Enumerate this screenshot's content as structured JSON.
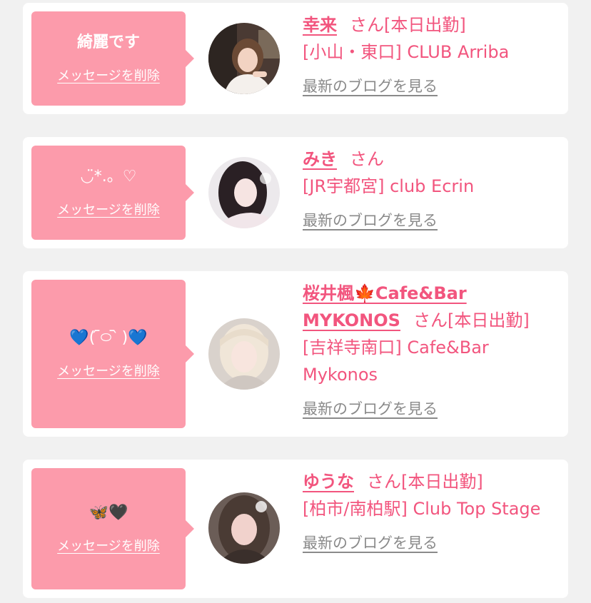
{
  "delete_label": "メッセージを削除",
  "blog_label": "最新のブログを見る",
  "san_label": "さん",
  "entries": [
    {
      "message": "綺麗です",
      "name": "幸来",
      "status": "[本日出勤]",
      "shop": "[小山・東口] CLUB Arriba"
    },
    {
      "message_parts": [
        "◡̈*.。♡"
      ],
      "name": "みき",
      "status": "",
      "shop": "[JR宇都宮] club Ecrin"
    },
    {
      "message_parts": [
        "💙",
        "( ᷇࿀ ᷆ )",
        "💙"
      ],
      "name": "桜井楓🍁Cafe&Bar MYKONOS",
      "status": "[本日出勤]",
      "shop": "[吉祥寺南口] Cafe&Bar Mykonos"
    },
    {
      "message_parts": [
        "🦋",
        "🖤"
      ],
      "name": "ゆうな",
      "status": "[本日出勤]",
      "shop": "[柏市/南柏駅] Club Top Stage"
    }
  ],
  "colors": {
    "bubble": "#fc9bab",
    "accent": "#f2557e",
    "blog_link": "#8a8a8a",
    "background": "#f1f1f1"
  }
}
